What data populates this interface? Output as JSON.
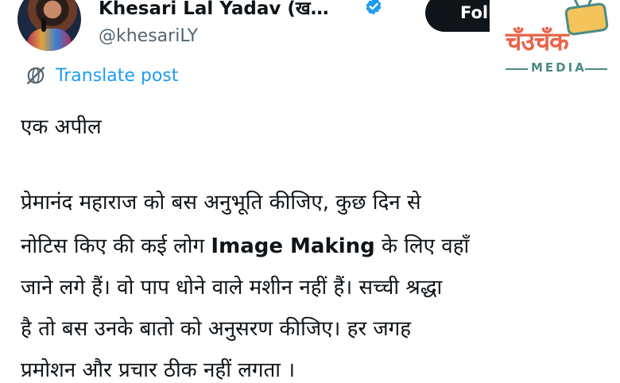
{
  "profile": {
    "display_name": "Khesari Lal Yadav (ख…",
    "handle": "@khesariLY",
    "follow_label": "Foll",
    "verified_icon": "verified-badge-icon",
    "verified_color": "#1d9bf0"
  },
  "translate": {
    "label": "Translate post",
    "icon": "globe-slash-icon",
    "color": "#1d9bf0"
  },
  "tweet": {
    "line1": "एक अपील",
    "line2": "प्रेमानंद महाराज को बस अनुभूति कीजिए, कुछ दिन से",
    "line3_a": "नोटिस किए की कई लोग ",
    "line3_b": "Image Making",
    "line3_c": " के लिए वहाँ",
    "line4": "जाने लगे हैं। वो पाप धोने वाले मशीन नहीं हैं। सच्ची श्रद्धा",
    "line5": "है तो बस उनके बातो को अनुसरण कीजिए। हर जगह",
    "line6": "प्रमोशन और प्रचार ठीक नहीं लगता ।"
  },
  "watermark": {
    "wordmark": "चँउचँक",
    "submark": "MEDIA",
    "brand_color": "#e8644a",
    "accent_color": "#4a8b86"
  }
}
